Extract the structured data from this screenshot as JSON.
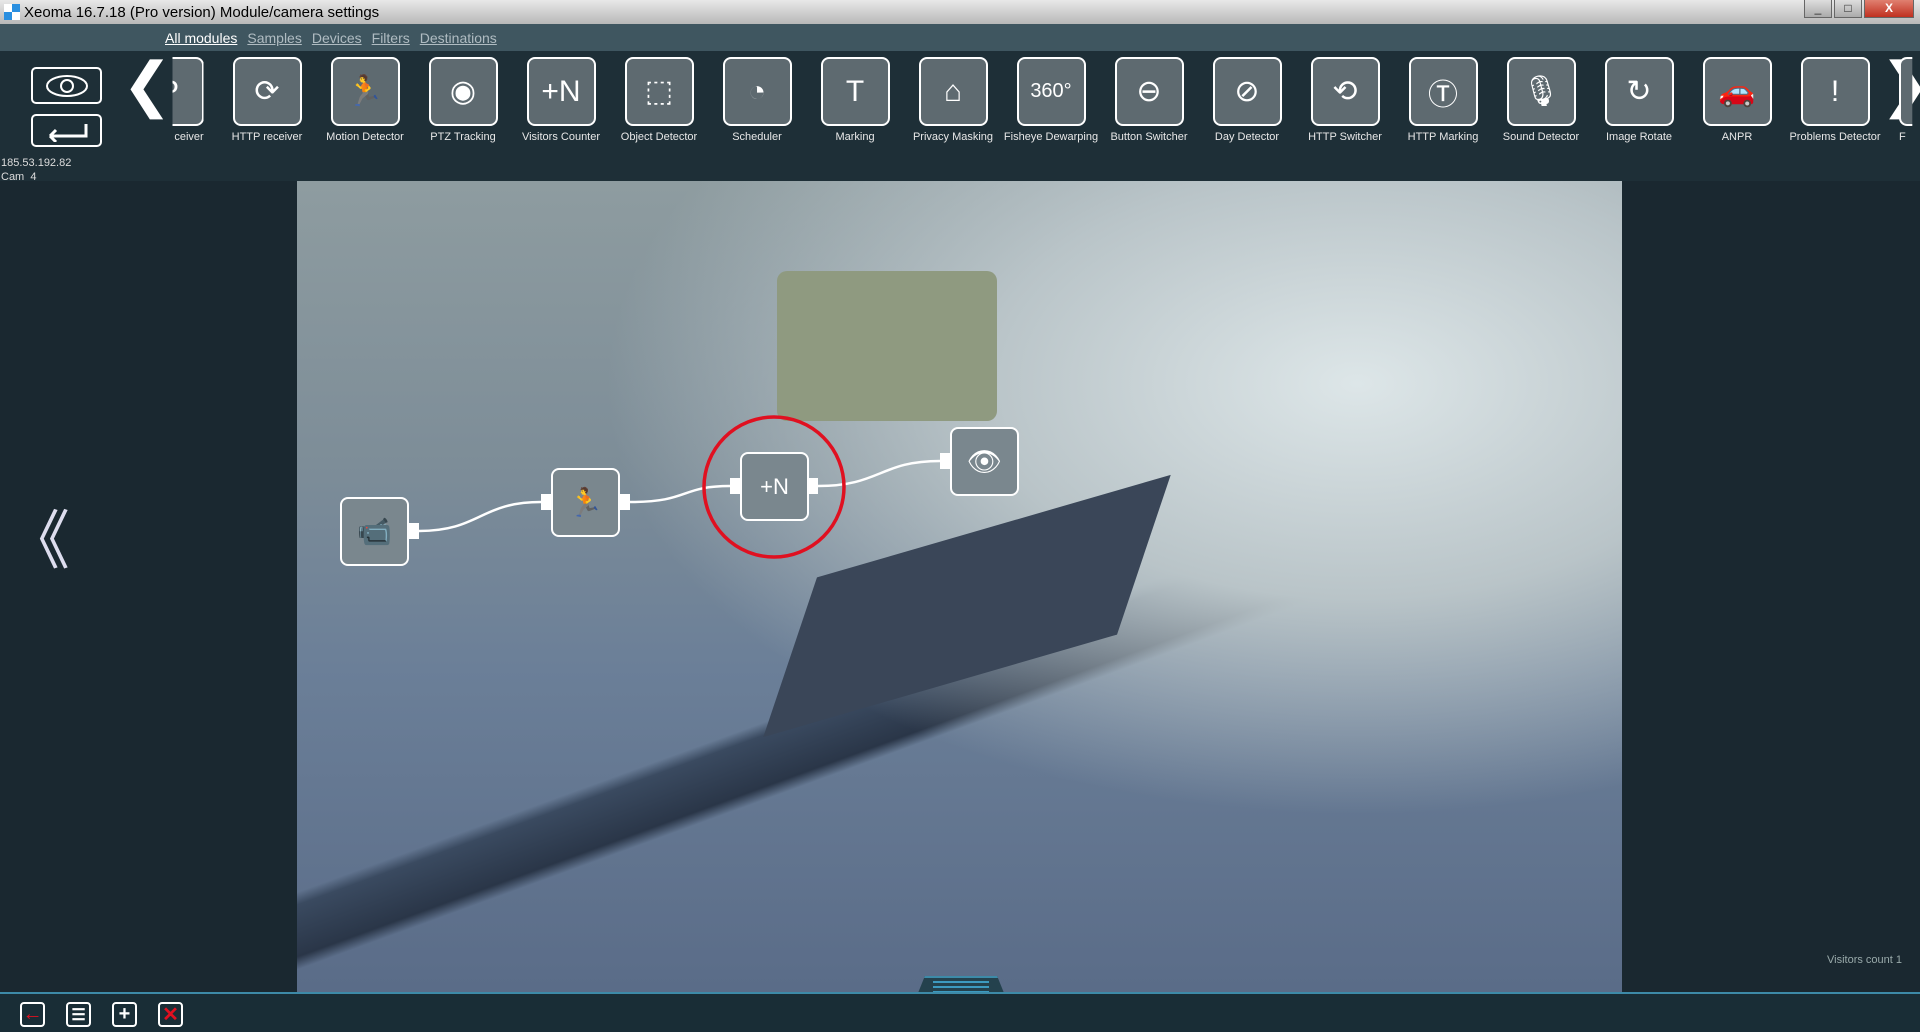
{
  "window": {
    "title": "Xeoma 16.7.18 (Pro version) Module/camera settings",
    "minimize": "_",
    "maximize": "□",
    "close": "X"
  },
  "tabs": [
    {
      "label": "All modules",
      "active": true
    },
    {
      "label": "Samples"
    },
    {
      "label": "Devices"
    },
    {
      "label": "Filters"
    },
    {
      "label": "Destinations"
    }
  ],
  "camera_info": {
    "ip": "185.53.192.82",
    "name": "Cam  4"
  },
  "modules": [
    {
      "label": "ceiver",
      "icon": "p-receiver-icon",
      "glyph": "P"
    },
    {
      "label": "HTTP receiver",
      "icon": "http-receiver-icon",
      "glyph": "⟳"
    },
    {
      "label": "Motion Detector",
      "icon": "motion-detector-icon",
      "glyph": "🏃"
    },
    {
      "label": "PTZ Tracking",
      "icon": "ptz-tracking-icon",
      "glyph": "◉"
    },
    {
      "label": "Visitors Counter",
      "icon": "visitors-counter-icon",
      "glyph": "+N"
    },
    {
      "label": "Object Detector",
      "icon": "object-detector-icon",
      "glyph": "⬚"
    },
    {
      "label": "Scheduler",
      "icon": "scheduler-icon",
      "glyph": "◔"
    },
    {
      "label": "Marking",
      "icon": "marking-icon",
      "glyph": "T"
    },
    {
      "label": "Privacy Masking",
      "icon": "privacy-masking-icon",
      "glyph": "⌂"
    },
    {
      "label": "Fisheye Dewarping",
      "icon": "fisheye-icon",
      "glyph": "360°"
    },
    {
      "label": "Button Switcher",
      "icon": "button-switcher-icon",
      "glyph": "⊖"
    },
    {
      "label": "Day Detector",
      "icon": "day-detector-icon",
      "glyph": "⊘"
    },
    {
      "label": "HTTP Switcher",
      "icon": "http-switcher-icon",
      "glyph": "⟲"
    },
    {
      "label": "HTTP Marking",
      "icon": "http-marking-icon",
      "glyph": "Ⓣ"
    },
    {
      "label": "Sound Detector",
      "icon": "sound-detector-icon",
      "glyph": "🎙"
    },
    {
      "label": "Image Rotate",
      "icon": "image-rotate-icon",
      "glyph": "↻"
    },
    {
      "label": "ANPR",
      "icon": "car-icon",
      "glyph": "🚗"
    },
    {
      "label": "Problems Detector",
      "icon": "exclamation-icon",
      "glyph": "!"
    },
    {
      "label": "F",
      "icon": "partial-module-icon",
      "glyph": ""
    }
  ],
  "chain": [
    "camera-source",
    "motion-detector",
    "visitors-counter",
    "viewer"
  ],
  "status": {
    "visitors_count": "Visitors count 1"
  },
  "colors": {
    "highlight": "#e01020",
    "accent": "#3d8aa8"
  }
}
